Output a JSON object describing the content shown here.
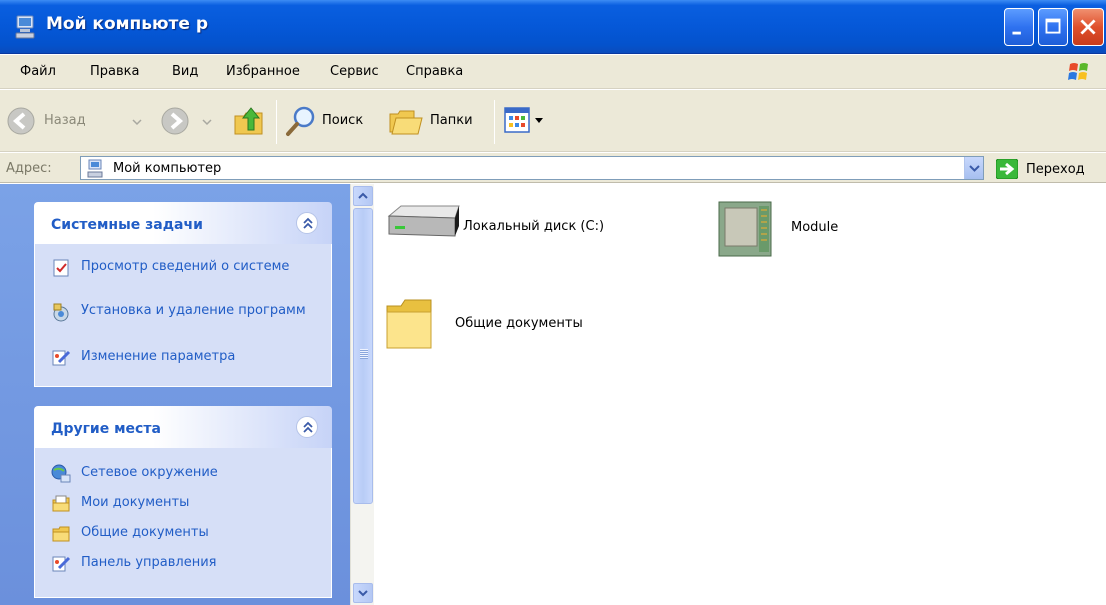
{
  "window": {
    "title": "Мой компьюте р",
    "icon": "my-computer-icon"
  },
  "menu": {
    "items": [
      {
        "label": "Файл"
      },
      {
        "label": "Правка"
      },
      {
        "label": "Вид"
      },
      {
        "label": "Избранное"
      },
      {
        "label": "Сервис"
      },
      {
        "label": "Справка"
      }
    ]
  },
  "toolbar": {
    "back_label": "Назад",
    "search_label": "Поиск",
    "folders_label": "Папки"
  },
  "address": {
    "label": "Адрес:",
    "value": "Мой компьютер",
    "go_label": "Переход"
  },
  "taskpane": {
    "system_tasks": {
      "title": "Системные задачи",
      "items": [
        {
          "label": "Просмотр сведений о системе",
          "icon": "system-info-icon"
        },
        {
          "label": "Установка и удаление программ",
          "icon": "add-remove-programs-icon"
        },
        {
          "label": "Изменение параметра",
          "icon": "control-panel-icon"
        }
      ]
    },
    "other_places": {
      "title": "Другие места",
      "items": [
        {
          "label": "Сетевое окружение",
          "icon": "network-places-icon"
        },
        {
          "label": "Мои документы",
          "icon": "my-documents-icon"
        },
        {
          "label": "Общие документы",
          "icon": "shared-documents-folder-icon"
        },
        {
          "label": "Панель управления",
          "icon": "control-panel-icon"
        }
      ]
    }
  },
  "content": {
    "items": [
      {
        "label": "Локальный диск (C:)",
        "icon": "hard-drive-icon"
      },
      {
        "label": "Module",
        "icon": "module-device-icon"
      },
      {
        "label": "Общие документы",
        "icon": "folder-icon"
      }
    ]
  },
  "colors": {
    "titlebar": "#0558d8",
    "taskpane_bg": "#7ba2e7",
    "panel_title": "#215dc6",
    "panel_body": "#d6dff7",
    "chrome": "#ece9d8",
    "close_button": "#e0502c"
  }
}
